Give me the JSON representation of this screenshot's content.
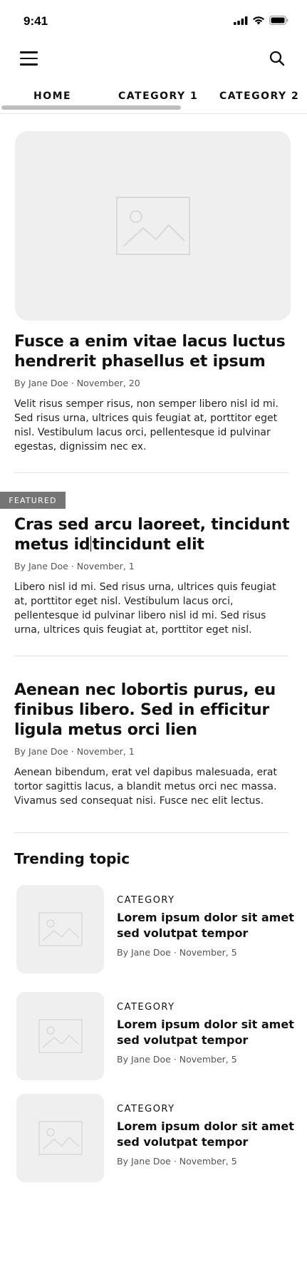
{
  "status_bar": {
    "time": "9:41",
    "icons": [
      "signal-icon",
      "wifi-icon",
      "battery-icon"
    ]
  },
  "app_bar": {
    "icons": [
      "menu-icon",
      "search-icon"
    ]
  },
  "tabs": [
    {
      "label": "HOME",
      "active": true
    },
    {
      "label": "CATEGORY 1"
    },
    {
      "label": "CATEGORY 2"
    }
  ],
  "articles": [
    {
      "title": "Fusce a enim vitae lacus luctus hendrerit phasellus et ipsum",
      "meta": "By Jane Doe · November, 20",
      "excerpt": "Velit risus semper risus, non semper libero nisl id mi. Sed risus urna, ultrices quis feugiat at, porttitor eget nisl. Vestibulum lacus orci, pellentesque id pulvinar egestas, dignissim nec ex."
    },
    {
      "badge": "FEATURED",
      "title_part1": "Cras sed arcu laoreet, tincidunt metus id",
      "title_part2": "tincidunt elit",
      "meta": "By Jane Doe · November, 1",
      "excerpt": "Libero nisl id mi. Sed risus urna, ultrices quis feugiat at, porttitor eget nisl. Vestibulum lacus orci, pellentesque id pulvinar libero nisl id mi. Sed risus urna, ultrices quis feugiat at, porttitor eget nisl."
    },
    {
      "title": "Aenean nec lobortis purus, eu finibus libero. Sed in efficitur ligula metus orci lien",
      "meta": "By Jane Doe · November, 1",
      "excerpt": "Aenean bibendum, erat vel dapibus malesuada, erat tortor sagittis lacus, a blandit metus orci nec massa. Vivamus sed consequat nisi. Fusce nec elit lectus."
    }
  ],
  "trending": {
    "heading": "Trending topic",
    "items": [
      {
        "category": "CATEGORY",
        "title": "Lorem ipsum dolor sit amet sed volutpat tempor",
        "meta": "By Jane Doe · November, 5"
      },
      {
        "category": "CATEGORY",
        "title": "Lorem ipsum dolor sit amet sed volutpat tempor",
        "meta": "By Jane Doe · November, 5"
      },
      {
        "category": "CATEGORY",
        "title": "Lorem ipsum dolor sit amet sed volutpat tempor",
        "meta": "By Jane Doe · November, 5"
      }
    ]
  },
  "colors": {
    "placeholder_bg": "#efefef",
    "badge_bg": "#757575",
    "text": "#111111",
    "muted": "#555555"
  }
}
